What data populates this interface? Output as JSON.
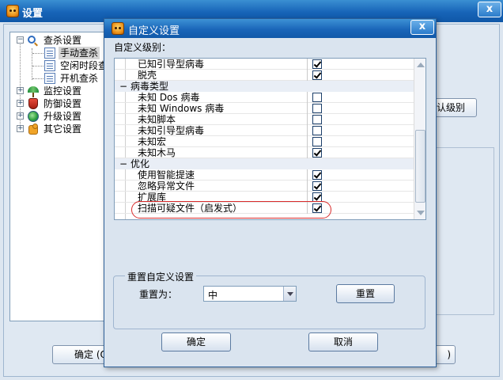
{
  "main_window": {
    "title": "设置",
    "close_label": "x",
    "tree": [
      {
        "label": "查杀设置",
        "icon": "magnifier-icon",
        "toggle": "−"
      },
      {
        "label": "手动查杀",
        "icon": "document-icon",
        "selected": true
      },
      {
        "label": "空闲时段查",
        "icon": "document-icon"
      },
      {
        "label": "开机查杀",
        "icon": "document-icon"
      },
      {
        "label": "监控设置",
        "icon": "umbrella-icon",
        "toggle": "+"
      },
      {
        "label": "防御设置",
        "icon": "shield-icon",
        "toggle": "+"
      },
      {
        "label": "升级设置",
        "icon": "globe-icon",
        "toggle": "+"
      },
      {
        "label": "其它设置",
        "icon": "puzzle-icon",
        "toggle": "+"
      }
    ],
    "default_level_button_fragment": "认级别",
    "ok_button_fragment": "确定 (O",
    "right_button_fragment": ")"
  },
  "dialog": {
    "title": "自定义设置",
    "close_label": "x",
    "level_label": "自定义级别：",
    "list": [
      {
        "type": "item",
        "name": "已知引导型病毒",
        "checked": true
      },
      {
        "type": "item",
        "name": "脱壳",
        "checked": true
      },
      {
        "type": "group",
        "name": "病毒类型",
        "toggle": "−"
      },
      {
        "type": "item",
        "name": "未知 Dos 病毒",
        "checked": false
      },
      {
        "type": "item",
        "name": "未知 Windows 病毒",
        "checked": false
      },
      {
        "type": "item",
        "name": "未知脚本",
        "checked": false
      },
      {
        "type": "item",
        "name": "未知引导型病毒",
        "checked": false
      },
      {
        "type": "item",
        "name": "未知宏",
        "checked": false
      },
      {
        "type": "item",
        "name": "未知木马",
        "checked": true
      },
      {
        "type": "group",
        "name": "优化",
        "toggle": "−"
      },
      {
        "type": "item",
        "name": "使用智能提速",
        "checked": true
      },
      {
        "type": "item",
        "name": "忽略异常文件",
        "checked": true
      },
      {
        "type": "item",
        "name": "扩展库",
        "checked": true
      },
      {
        "type": "item",
        "name": "扫描可疑文件（启发式）",
        "checked": true,
        "highlighted": true
      }
    ],
    "reset_group_title": "重置自定义设置",
    "reset_to_label": "重置为：",
    "reset_level_value": "中",
    "reset_button": "重置",
    "ok_button": "确定",
    "cancel_button": "取消",
    "highlight_color": "#d92b2b"
  }
}
